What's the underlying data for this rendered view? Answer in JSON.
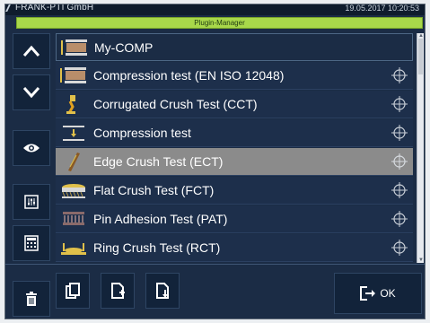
{
  "header": {
    "company": "FRANK-PTI GmbH",
    "datetime": "19.05.2017 10:20:53"
  },
  "window": {
    "title": "Plugin-Manager"
  },
  "sidebar": {
    "buttons": [
      {
        "name": "up-button",
        "icon": "chevron-up-icon"
      },
      {
        "name": "down-button",
        "icon": "chevron-down-icon"
      },
      {
        "name": "view-button",
        "icon": "eye-icon"
      },
      {
        "name": "settings-button",
        "icon": "sliders-icon"
      },
      {
        "name": "calculator-button",
        "icon": "calculator-icon"
      },
      {
        "name": "delete-button",
        "icon": "trash-icon"
      }
    ]
  },
  "plugin_list": {
    "header_label": "My-COMP",
    "items": [
      {
        "label": "Compression test (EN ISO 12048)",
        "icon": "compression-icon",
        "selected": false
      },
      {
        "label": "Corrugated Crush Test (CCT)",
        "icon": "cct-icon",
        "selected": false
      },
      {
        "label": "Compression test",
        "icon": "compression-small-icon",
        "selected": false
      },
      {
        "label": "Edge Crush Test (ECT)",
        "icon": "ect-icon",
        "selected": true
      },
      {
        "label": "Flat Crush Test (FCT)",
        "icon": "fct-icon",
        "selected": false
      },
      {
        "label": "Pin Adhesion Test (PAT)",
        "icon": "pat-icon",
        "selected": false
      },
      {
        "label": "Ring Crush Test (RCT)",
        "icon": "rct-icon",
        "selected": false
      }
    ]
  },
  "footer": {
    "ok_label": "OK"
  }
}
